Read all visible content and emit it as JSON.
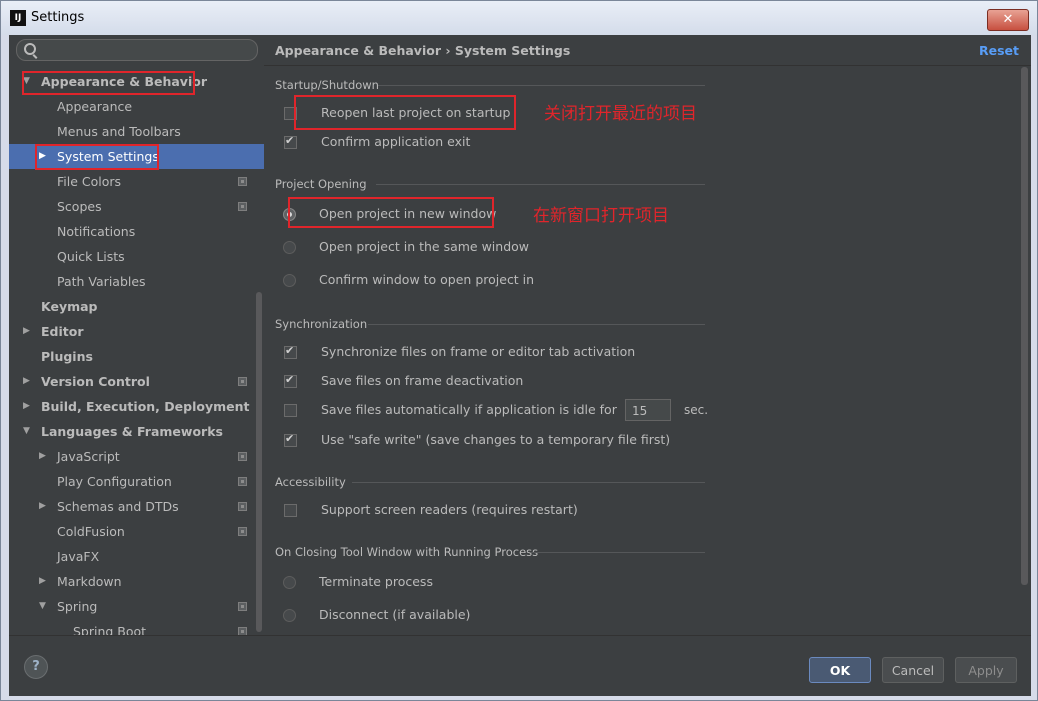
{
  "window": {
    "title": "Settings",
    "app_icon": "IJ",
    "close_glyph": "✕"
  },
  "search": {
    "placeholder": ""
  },
  "sidebar": {
    "items": [
      {
        "label": "Appearance & Behavior",
        "arrow": "▼"
      },
      {
        "label": "Appearance"
      },
      {
        "label": "Menus and Toolbars"
      },
      {
        "label": "System Settings",
        "arrow": "▶",
        "selected": true
      },
      {
        "label": "File Colors"
      },
      {
        "label": "Scopes"
      },
      {
        "label": "Notifications"
      },
      {
        "label": "Quick Lists"
      },
      {
        "label": "Path Variables"
      },
      {
        "label": "Keymap"
      },
      {
        "label": "Editor",
        "arrow": "▶"
      },
      {
        "label": "Plugins"
      },
      {
        "label": "Version Control",
        "arrow": "▶"
      },
      {
        "label": "Build, Execution, Deployment",
        "arrow": "▶"
      },
      {
        "label": "Languages & Frameworks",
        "arrow": "▼"
      },
      {
        "label": "JavaScript",
        "arrow": "▶"
      },
      {
        "label": "Play Configuration"
      },
      {
        "label": "Schemas and DTDs",
        "arrow": "▶"
      },
      {
        "label": "ColdFusion"
      },
      {
        "label": "JavaFX"
      },
      {
        "label": "Markdown",
        "arrow": "▶"
      },
      {
        "label": "Spring",
        "arrow": "▼"
      },
      {
        "label": "Spring Boot"
      }
    ]
  },
  "main": {
    "breadcrumb": "Appearance & Behavior › System Settings",
    "reset_label": "Reset",
    "startup": {
      "title": "Startup/Shutdown",
      "reopen_label": "Reopen last project on startup",
      "reopen_checked": false,
      "confirm_exit_label": "Confirm application exit",
      "confirm_exit_checked": true
    },
    "project_opening": {
      "title": "Project Opening",
      "options": [
        "Open project in new window",
        "Open project in the same window",
        "Confirm window to open project in"
      ],
      "selected": "Open project in new window"
    },
    "sync": {
      "title": "Synchronization",
      "sync_files_label": "Synchronize files on frame or editor tab activation",
      "sync_files_checked": true,
      "save_deactivation_label": "Save files on frame deactivation",
      "save_deactivation_checked": true,
      "save_idle_label": "Save files automatically if application is idle for",
      "save_idle_checked": false,
      "idle_seconds": "15",
      "idle_unit": "sec.",
      "safe_write_label": "Use \"safe write\" (save changes to a temporary file first)",
      "safe_write_checked": true
    },
    "accessibility": {
      "title": "Accessibility",
      "screen_readers_label": "Support screen readers (requires restart)",
      "screen_readers_checked": false
    },
    "closing": {
      "title": "On Closing Tool Window with Running Process",
      "options": [
        "Terminate process",
        "Disconnect (if available)"
      ]
    }
  },
  "annotations": {
    "note1": "关闭打开最近的项目",
    "note2": "在新窗口打开项目",
    "color": "#e0252b"
  },
  "buttons": {
    "help": "?",
    "ok": "OK",
    "cancel": "Cancel",
    "apply": "Apply"
  }
}
